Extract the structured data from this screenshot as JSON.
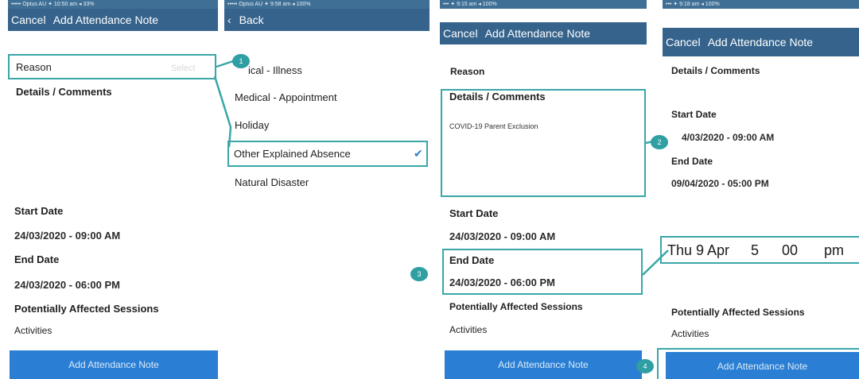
{
  "panel1": {
    "status": "••••• Optus AU ✦ 10:50 am ◂ 33%",
    "nav": {
      "cancel": "Cancel",
      "title": "Add Attendance Note"
    },
    "reason_label": "Reason",
    "reason_placeholder": "Select",
    "details_label": "Details / Comments",
    "start_label": "Start Date",
    "start_value": "24/03/2020 - 09:00 AM",
    "end_label": "End Date",
    "end_value": "24/03/2020 - 06:00 PM",
    "sessions_label": "Potentially Affected Sessions",
    "activities": "Activities",
    "button": "Add Attendance Note"
  },
  "panel2": {
    "status": "••••• Optus AU ✦ 9:58 am ◂ 100%",
    "nav": {
      "back": "Back"
    },
    "items": [
      {
        "label": "Medical - Illness",
        "visible_text": "ical - Illness"
      },
      {
        "label": "Medical - Appointment"
      },
      {
        "label": "Holiday"
      },
      {
        "label": "Other Explained Absence",
        "selected": true
      },
      {
        "label": "Natural Disaster"
      }
    ],
    "check_icon": "✔"
  },
  "panel3": {
    "status": "••• ✦ 9:15 am ◂ 100%",
    "nav": {
      "cancel": "Cancel",
      "title": "Add Attendance Note"
    },
    "reason_label": "Reason",
    "details_label": "Details / Comments",
    "details_text": "COVID-19 Parent Exclusion",
    "start_label": "Start Date",
    "start_value": "24/03/2020 - 09:00 AM",
    "end_label": "End Date",
    "end_value": "24/03/2020 - 06:00 PM",
    "sessions_label": "Potentially Affected Sessions",
    "activities": "Activities",
    "button": "Add Attendance Note"
  },
  "panel4": {
    "status": "••• ✦ 9:18 am ◂ 100%",
    "nav": {
      "cancel": "Cancel",
      "title": "Add Attendance Note"
    },
    "details_label": "Details / Comments",
    "start_label": "Start Date",
    "start_value": "24/03/2020 - 09:00 AM",
    "start_value_visible": "4/03/2020 - 09:00 AM",
    "end_label": "End Date",
    "end_value": "09/04/2020 - 05:00 PM",
    "picker": {
      "day": "Thu 9 Apr",
      "hour": "5",
      "minute": "00",
      "ampm": "pm"
    },
    "sessions_label": "Potentially Affected Sessions",
    "activities": "Activities",
    "button": "Add Attendance Note"
  },
  "markers": {
    "m1": "1",
    "m2": "2",
    "m3": "3",
    "m4": "4"
  },
  "colors": {
    "nav": "#35638c",
    "highlight": "#3aa6a8",
    "button": "#2a7fd4"
  }
}
